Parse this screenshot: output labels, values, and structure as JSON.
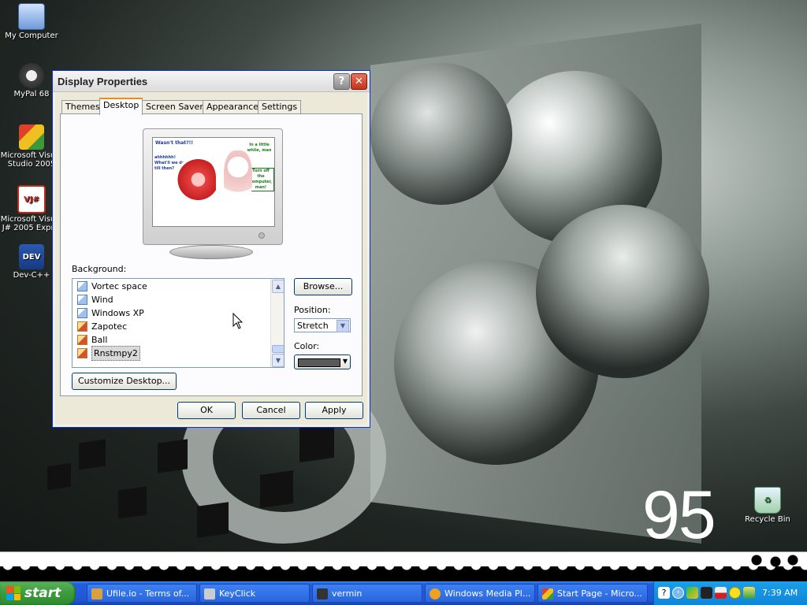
{
  "desktop_icons": [
    {
      "label": "My Computer"
    },
    {
      "label": "MyPal 68"
    },
    {
      "label": "Microsoft Visual Studio 2005"
    },
    {
      "label": "Microsoft Visual J# 2005 Expr..."
    },
    {
      "label": "Dev-C++"
    },
    {
      "label": "Recycle Bin"
    }
  ],
  "wallpaper": {
    "number": "95"
  },
  "window": {
    "title": "Display Properties",
    "tabs": [
      "Themes",
      "Desktop",
      "Screen Saver",
      "Appearance",
      "Settings"
    ],
    "active_tab": "Desktop",
    "preview_texts": [
      "Wasn't that?!!",
      "ahhhhhh! What'll we do till then?",
      "In a little while, man",
      "Turn off the computer, man!"
    ],
    "background_label": "Background:",
    "background_items": [
      "Vortec space",
      "Wind",
      "Windows XP",
      "Zapotec",
      "Ball",
      "Rnstmpy2"
    ],
    "selected_background": "Rnstmpy2",
    "browse_label": "Browse...",
    "position_label": "Position:",
    "position_value": "Stretch",
    "color_label": "Color:",
    "color_value": "#5a5a5a",
    "customize_label": "Customize Desktop...",
    "ok_label": "OK",
    "cancel_label": "Cancel",
    "apply_label": "Apply"
  },
  "taskbar": {
    "start_label": "start",
    "tasks": [
      "Ufile.io - Terms of...",
      "KeyClick",
      "vermin",
      "Windows Media Pl...",
      "Start Page - Micro..."
    ],
    "clock": "7:39 AM"
  }
}
